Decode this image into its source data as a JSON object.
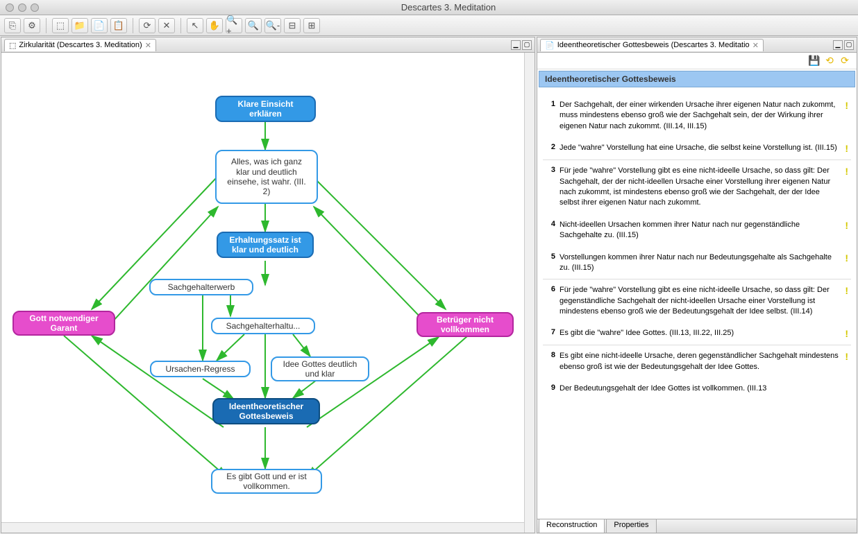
{
  "window": {
    "title": "Descartes 3. Meditation"
  },
  "toolbar_icons": [
    "⎘",
    "⚙",
    "⬚",
    "📁",
    "📄",
    "📋",
    "⟳",
    "✕",
    "↖",
    "✋",
    "🔍+",
    "🔍",
    "🔍-",
    "⊟",
    "⊞"
  ],
  "left": {
    "tab_title": "Zirkularität (Descartes 3. Meditation)",
    "nodes": {
      "n1": "Klare Einsicht erklären",
      "n2": "Alles, was ich ganz klar und deutlich einsehe, ist wahr. (III. 2)",
      "n3": "Erhaltungssatz ist klar und deutlich",
      "n4": "Sachgehalterwerb",
      "n5": "Sachgehalterhaltu...",
      "n6": "Ursachen-Regress",
      "n7": "Idee Gottes deutlich und klar",
      "n8": "Ideentheoretischer Gottesbeweis",
      "n9": "Es gibt Gott und er ist vollkommen.",
      "n10": "Gott notwendiger Garant",
      "n11": "Betrüger nicht vollkommen"
    }
  },
  "right": {
    "tab_title": "Ideentheoretischer Gottesbeweis (Descartes 3. Meditatio",
    "section": "Ideentheoretischer Gottesbeweis",
    "props": [
      {
        "n": "1",
        "t": "Der Sachgehalt, der einer wirkenden Ursache ihrer eigenen Natur nach zukommt, muss mindestens ebenso groß wie der Sachgehalt sein, der der Wirkung ihrer eigenen Natur nach zukommt. (III.14, III.15)"
      },
      {
        "n": "2",
        "t": "Jede \"wahre\" Vorstellung hat eine Ursache, die selbst keine Vorstellung ist. (III.15)"
      },
      {
        "n": "3",
        "t": "Für jede \"wahre\" Vorstellung gibt es eine nicht-ideelle Ursache, so dass gilt: Der Sachgehalt, der der nicht-ideellen Ursache einer Vorstellung ihrer eigenen Natur nach zukommt, ist mindestens ebenso groß wie der Sachgehalt, der der Idee selbst ihrer eigenen Natur nach zukommt."
      },
      {
        "n": "4",
        "t": "Nicht-ideellen Ursachen kommen ihrer Natur nach nur gegenständliche Sachgehalte zu. (III.15)"
      },
      {
        "n": "5",
        "t": "Vorstellungen kommen ihrer Natur nach nur Bedeutungsgehalte als Sachgehalte zu. (III.15)"
      },
      {
        "n": "6",
        "t": "Für jede \"wahre\" Vorstellung gibt es eine nicht-ideelle Ursache, so dass gilt: Der gegenständliche Sachgehalt der nicht-ideellen Ursache einer Vorstellung ist mindestens ebenso groß wie der Bedeutungsgehalt der Idee selbst. (III.14)"
      },
      {
        "n": "7",
        "t": "Es gibt die \"wahre\" Idee Gottes. (III.13, III.22, III.25)"
      },
      {
        "n": "8",
        "t": "Es gibt eine nicht-ideelle Ursache, deren gegenständlicher Sachgehalt mindestens ebenso groß ist wie der Bedeutungsgehalt der Idee Gottes."
      },
      {
        "n": "9",
        "t": "Der Bedeutungsgehalt der Idee Gottes ist vollkommen. (III.13"
      }
    ],
    "bottom_tabs": [
      "Reconstruction",
      "Properties"
    ]
  }
}
